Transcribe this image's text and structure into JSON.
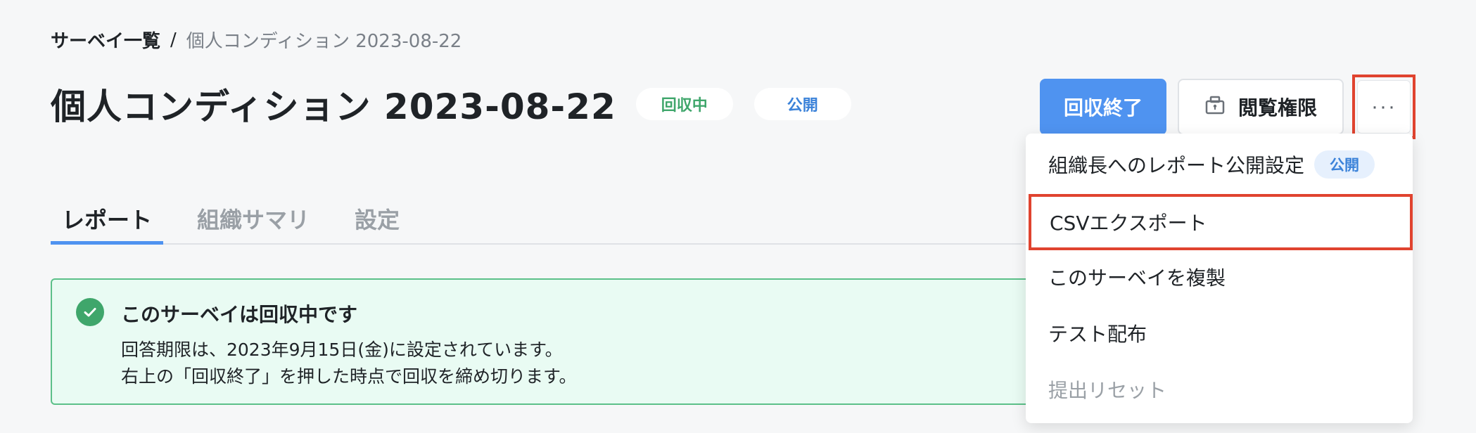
{
  "breadcrumb": {
    "root": "サーベイ一覧",
    "separator": "/",
    "current": "個人コンディション 2023-08-22"
  },
  "header": {
    "title": "個人コンディション 2023-08-22",
    "status_badge": "回収中",
    "visibility_badge": "公開"
  },
  "actions": {
    "primary_label": "回収終了",
    "secondary_label": "閲覧権限",
    "secondary_icon": "lock-icon",
    "more_label": "···"
  },
  "tabs": [
    {
      "label": "レポート",
      "active": true
    },
    {
      "label": "組織サマリ",
      "active": false
    },
    {
      "label": "設定",
      "active": false
    }
  ],
  "notice": {
    "icon": "check-circle-icon",
    "title": "このサーベイは回収中です",
    "line1": "回答期限は、2023年9月15日(金)に設定されています。",
    "line2": "右上の「回収終了」を押した時点で回収を締め切ります。"
  },
  "dropdown": {
    "items": [
      {
        "label": "組織長へのレポート公開設定",
        "badge": "公開"
      },
      {
        "label": "CSVエクスポート"
      },
      {
        "label": "このサーベイを複製"
      },
      {
        "label": "テスト配布"
      },
      {
        "label": "提出リセット",
        "disabled": true
      }
    ]
  },
  "colors": {
    "accent": "#4f93f0",
    "success": "#3fa66b",
    "highlight": "#e0432f"
  }
}
